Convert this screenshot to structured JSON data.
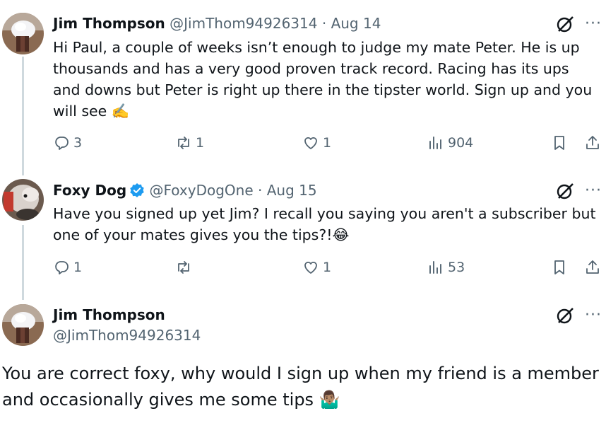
{
  "tweets": [
    {
      "author": "Jim Thompson",
      "handle": "@JimThom94926314",
      "separator": "·",
      "date": "Aug 14",
      "text": "Hi Paul, a couple of weeks isn’t enough to judge my mate Peter. He is up thousands and has a very good proven track record. Racing has its ups and downs but Peter is right up there in the tipster world. Sign up and you will see ✍️",
      "replies": "3",
      "reposts": "1",
      "likes": "1",
      "views": "904"
    },
    {
      "author": "Foxy Dog",
      "handle": "@FoxyDogOne",
      "separator": "·",
      "date": "Aug 15",
      "text": "Have you signed up yet Jim? I recall you saying you aren't a subscriber but one of your mates gives you the tips?!😂",
      "replies": "1",
      "reposts": "",
      "likes": "1",
      "views": "53"
    }
  ],
  "focused": {
    "author": "Jim Thompson",
    "handle": "@JimThom94926314",
    "text": "You are correct foxy, why would I sign up when my friend is a member and occasionally gives me some tips 🤷🏽‍♂️"
  },
  "icons": {
    "reply": "reply-icon",
    "repost": "repost-icon",
    "like": "heart-icon",
    "views": "views-icon",
    "bookmark": "bookmark-icon",
    "share": "share-icon",
    "grok": "grok-icon",
    "more": "more-icon",
    "verified": "verified-badge-icon"
  },
  "colors": {
    "text": "#0f1419",
    "muted": "#536471",
    "thread_line": "#cfd9de",
    "verified": "#1d9bf0"
  },
  "more_glyph": "···"
}
